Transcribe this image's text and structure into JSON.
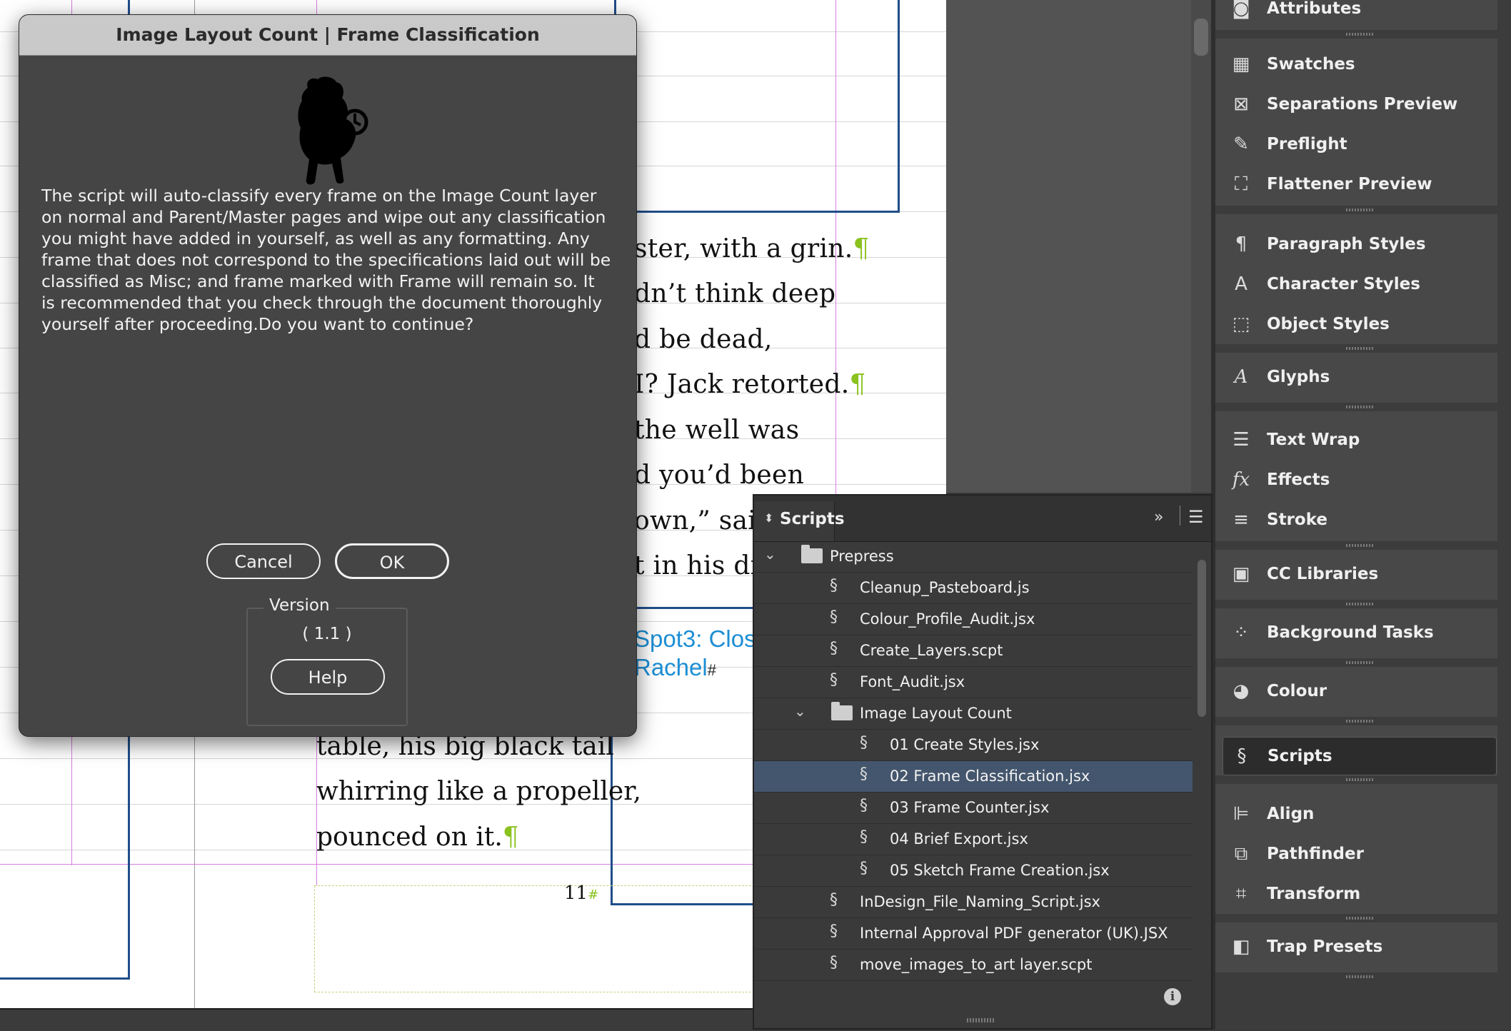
{
  "dialog": {
    "title": "Image Layout Count | Frame Classification",
    "message": "The script will auto-classify every frame on the Image Count layer on normal and Parent/Master pages and wipe out any classification you might have added in yourself, as well as any formatting. Any frame that does not correspond to the specifications laid out will be classified as Misc; and frame marked with Frame will remain so. It is recommended that you check through the document thoroughly yourself after proceeding.Do you want to continue?",
    "cancel_label": "Cancel",
    "ok_label": "OK",
    "version_label": "Version",
    "version_value": "( 1.1 )",
    "help_label": "Help"
  },
  "document": {
    "story_lines": [
      "ster, with a grin.",
      "dn’t think deep",
      "d be dead,",
      "I? Jack retorted.",
      " the well was",
      "d you’d been",
      "own,” said",
      "t in his dir"
    ],
    "story_lines_lower": [
      "table, his big black tail",
      "whirring like a propeller,",
      "pounced on it."
    ],
    "spot_label_line1": "Spot3: Clos",
    "spot_label_line2": "Rachel",
    "page_number": "11"
  },
  "scripts_panel": {
    "title": "Scripts",
    "items": [
      {
        "label": "Prepress",
        "kind": "folder",
        "level": 0,
        "expanded": true
      },
      {
        "label": "Cleanup_Pasteboard.js",
        "kind": "script",
        "level": 1
      },
      {
        "label": "Colour_Profile_Audit.jsx",
        "kind": "script",
        "level": 1
      },
      {
        "label": "Create_Layers.scpt",
        "kind": "applescript",
        "level": 1
      },
      {
        "label": "Font_Audit.jsx",
        "kind": "script",
        "level": 1
      },
      {
        "label": "Image Layout Count",
        "kind": "folder",
        "level": 1,
        "expanded": true
      },
      {
        "label": "01 Create Styles.jsx",
        "kind": "script",
        "level": 2
      },
      {
        "label": "02 Frame Classification.jsx",
        "kind": "script",
        "level": 2,
        "selected": true
      },
      {
        "label": "03 Frame Counter.jsx",
        "kind": "script",
        "level": 2
      },
      {
        "label": "04 Brief Export.jsx",
        "kind": "script",
        "level": 2
      },
      {
        "label": "05 Sketch Frame Creation.jsx",
        "kind": "script",
        "level": 2
      },
      {
        "label": "InDesign_File_Naming_Script.jsx",
        "kind": "script",
        "level": 1
      },
      {
        "label": "Internal Approval PDF generator (UK).JSX",
        "kind": "script",
        "level": 1
      },
      {
        "label": "move_images_to_art layer.scpt",
        "kind": "applescript",
        "level": 1
      }
    ]
  },
  "dock": {
    "attributes": "Attributes",
    "swatches": "Swatches",
    "separations_preview": "Separations Preview",
    "preflight": "Preflight",
    "flattener_preview": "Flattener Preview",
    "paragraph_styles": "Paragraph Styles",
    "character_styles": "Character Styles",
    "object_styles": "Object Styles",
    "glyphs": "Glyphs",
    "text_wrap": "Text Wrap",
    "effects": "Effects",
    "stroke": "Stroke",
    "cc_libraries": "CC Libraries",
    "background_tasks": "Background Tasks",
    "colour": "Colour",
    "scripts": "Scripts",
    "align": "Align",
    "pathfinder": "Pathfinder",
    "transform": "Transform",
    "trap_presets": "Trap Presets"
  },
  "colors": {
    "selection": "#44566d",
    "guide_magenta": "#d77ee0",
    "frame_blue": "#1f4e8a",
    "pilcrow_green": "#8ac21e",
    "spot_cyan": "#1c8ed4"
  }
}
